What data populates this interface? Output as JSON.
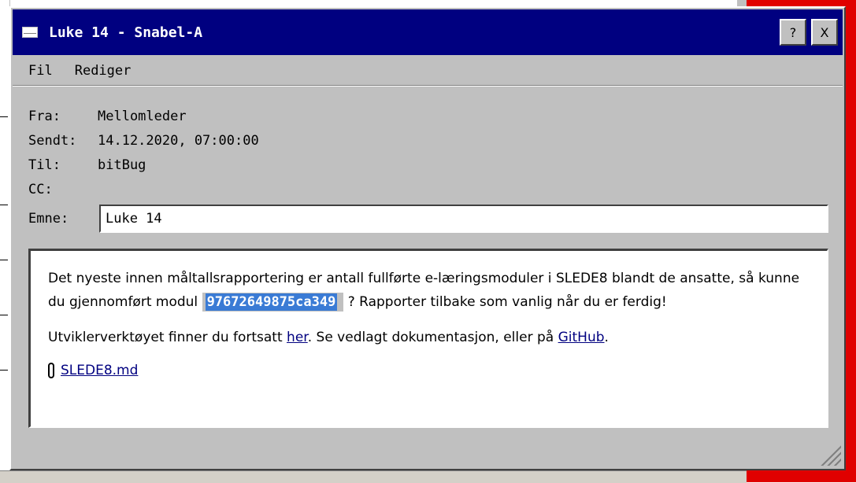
{
  "window": {
    "title": "Luke 14 - Snabel-A",
    "help_label": "?",
    "close_label": "X"
  },
  "menu": {
    "items": [
      "Fil",
      "Rediger"
    ]
  },
  "header": {
    "from_label": "Fra:",
    "from_value": "Mellomleder",
    "sent_label": "Sendt:",
    "sent_value": "14.12.2020, 07:00:00",
    "to_label": "Til:",
    "to_value": "bitBug",
    "cc_label": "CC:",
    "cc_value": "",
    "subject_label": "Emne:",
    "subject_value": "Luke 14"
  },
  "body": {
    "p1_before": "Det nyeste innen måltallsrapportering er antall fullførte e-læringsmoduler i SLEDE8 blandt de ansatte, så kunne du gjennomført modul ",
    "module_code": "97672649875ca349",
    "p1_after": " ? Rapporter tilbake som vanlig når du er ferdig!",
    "p2_before": "Utviklerverktøyet finner du fortsatt ",
    "p2_link1": "her",
    "p2_middle": ". Se vedlagt dokumentasjon, eller på ",
    "p2_link2": "GitHub",
    "p2_end": ".",
    "attachment": "SLEDE8.md"
  },
  "colors": {
    "titlebar": "#000080",
    "window_face": "#c0c0c0",
    "selection": "#3a7bd5",
    "background_app": "#e00000"
  }
}
